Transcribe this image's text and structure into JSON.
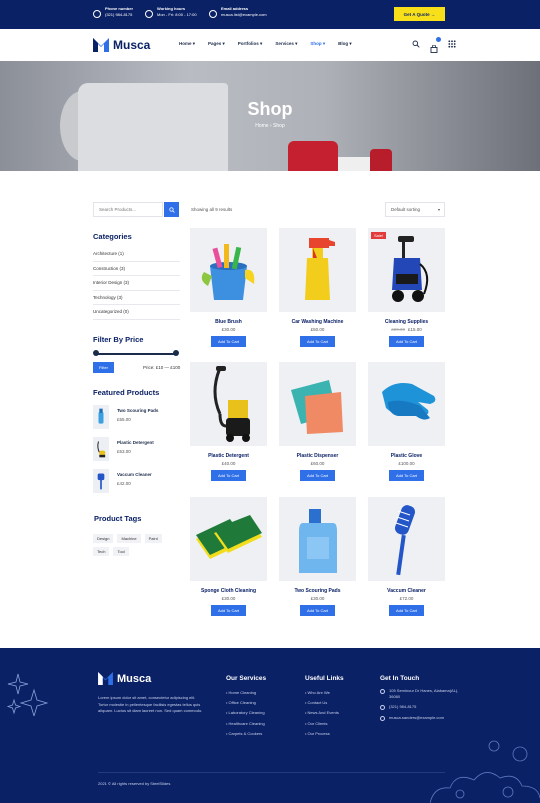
{
  "topbar": {
    "phone_label": "Phone number",
    "phone_value": "(321) 984-8175",
    "hours_label": "Working hours",
    "hours_value": "Mon - Fri: 8:00 - 17:00",
    "email_label": "Email address",
    "email_value": "musca.list@example.com",
    "quote_button": "Get A Quote →"
  },
  "header": {
    "logo": "Musca",
    "nav": [
      "Home ▾",
      "Pages ▾",
      "Portfolios ▾",
      "Services ▾",
      "Shop ▾",
      "Blog ▾"
    ],
    "nav_active_index": 4,
    "icons": [
      "search-icon",
      "cart-icon",
      "grid-menu-icon"
    ]
  },
  "hero": {
    "title": "Shop",
    "breadcrumb_home": "Home",
    "breadcrumb_sep": "›",
    "breadcrumb_current": "Shop"
  },
  "sidebar": {
    "search_placeholder": "Search Products...",
    "categories_title": "Categories",
    "categories": [
      "Architecture (1)",
      "Construction (3)",
      "Interior Design (3)",
      "Technology (3)",
      "Uncategorized (0)"
    ],
    "filter_title": "Filter By Price",
    "filter_button": "Filter",
    "price_range": "Price: £10 — £100",
    "price_min_fraction": 0.0,
    "price_max_fraction": 1.0,
    "featured_title": "Featured Products",
    "featured": [
      {
        "name": "Two Scouring Pads",
        "price": "£55.00"
      },
      {
        "name": "Plastic Detergent",
        "price": "£53.00"
      },
      {
        "name": "Vaccum Cleaner",
        "price": "£42.00"
      }
    ],
    "tags_title": "Product Tags",
    "tags": [
      "Design",
      "Machine",
      "Paint",
      "Tech",
      "Tool"
    ]
  },
  "shop": {
    "result_count": "Showing all 9 results",
    "sorting": "Default sorting",
    "add_to_cart": "Add To Cart",
    "sale_badge": "Sale!",
    "products": [
      {
        "name": "Blue Brush",
        "price": "£30.00",
        "old_price": "",
        "sale": false,
        "image": "bucket-icon"
      },
      {
        "name": "Car Washing Machine",
        "price": "£50.00",
        "old_price": "",
        "sale": false,
        "image": "spray-bottle-icon"
      },
      {
        "name": "Cleaning Supplies",
        "price": "£15.00",
        "old_price": "£20.00",
        "sale": true,
        "image": "pressure-washer-icon"
      },
      {
        "name": "Plastic Detergent",
        "price": "£40.00",
        "old_price": "",
        "sale": false,
        "image": "vacuum-icon"
      },
      {
        "name": "Plastic Dispenser",
        "price": "£60.00",
        "old_price": "",
        "sale": false,
        "image": "cloth-icon"
      },
      {
        "name": "Plastic Glove",
        "price": "£100.00",
        "old_price": "",
        "sale": false,
        "image": "glove-icon"
      },
      {
        "name": "Sponge Cloth Cleaning",
        "price": "£30.00",
        "old_price": "",
        "sale": false,
        "image": "sponge-icon"
      },
      {
        "name": "Two Scouring Pads",
        "price": "£30.00",
        "old_price": "",
        "sale": false,
        "image": "detergent-jug-icon"
      },
      {
        "name": "Vaccum Cleaner",
        "price": "£72.00",
        "old_price": "",
        "sale": false,
        "image": "brush-icon"
      }
    ]
  },
  "footer": {
    "logo": "Musca",
    "about": "Lorem ipsum dolor sit amet, consectetur adipiscing elit. Tortor molestie in pellentesque facilisis egestas tellus quis aliquam. Luctus sit diam laoreet non. Sed quam commodo.",
    "services_title": "Our Services",
    "services": [
      "Home Cleaning",
      "Office Cleaning",
      "Laboratory Cleaning",
      "Healthcare Cleaning",
      "Carpets & Cookers"
    ],
    "links_title": "Useful Links",
    "links": [
      "Who Are We",
      "Contact Us",
      "News And Events",
      "Our Clients",
      "Our Process"
    ],
    "contact_title": "Get In Touch",
    "address": "105 Seminour Dr Hanes, Alabama(AL), 36080",
    "phone": "(321) 984-8175",
    "email": "musca.sanders@example.com",
    "copyright": "2021 © All rights reserved by SteelSlides"
  },
  "colors": {
    "navy": "#0b2166",
    "accent": "#2f6fe8",
    "quote_yellow": "#f7e01a",
    "sale_red": "#e23b3b"
  }
}
